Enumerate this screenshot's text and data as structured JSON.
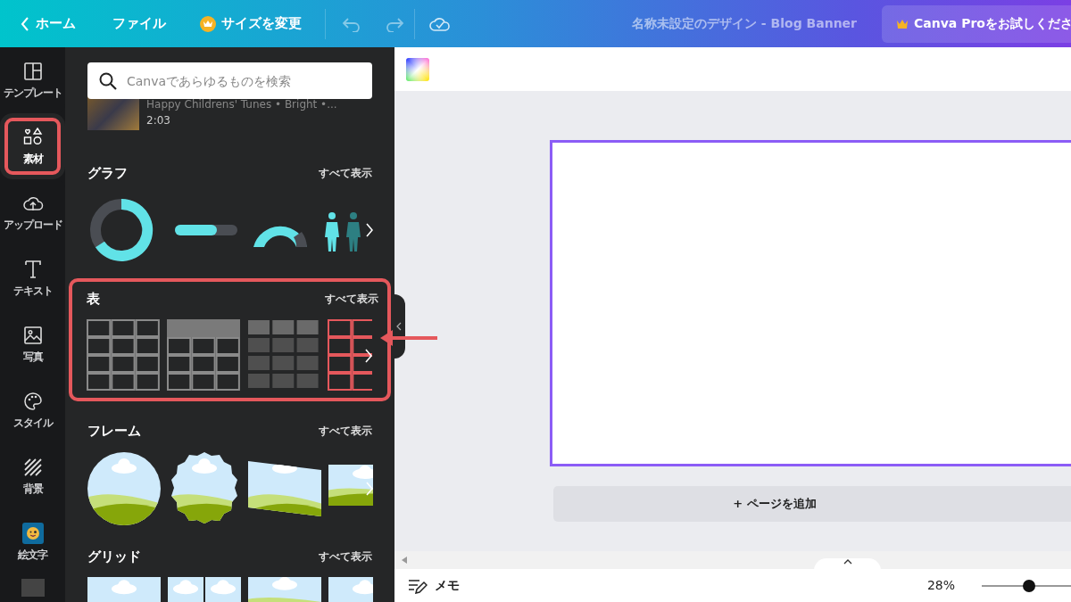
{
  "topbar": {
    "home": "ホーム",
    "file": "ファイル",
    "resize": "サイズを変更",
    "title": "名称未設定のデザイン - Blog Banner",
    "pro": "Canva Proをお試しくださ"
  },
  "rail": [
    {
      "label": "テンプレート",
      "kind": "template",
      "selected": false,
      "highlighted": false
    },
    {
      "label": "素材",
      "kind": "elements",
      "selected": true,
      "highlighted": true
    },
    {
      "label": "アップロード",
      "kind": "upload",
      "selected": false,
      "highlighted": false
    },
    {
      "label": "テキスト",
      "kind": "text",
      "selected": false,
      "highlighted": false
    },
    {
      "label": "写真",
      "kind": "photo",
      "selected": false,
      "highlighted": false
    },
    {
      "label": "スタイル",
      "kind": "style",
      "selected": false,
      "highlighted": false
    },
    {
      "label": "背景",
      "kind": "background",
      "selected": false,
      "highlighted": false
    },
    {
      "label": "絵文字",
      "kind": "emoji",
      "selected": false,
      "highlighted": false
    }
  ],
  "search": {
    "placeholder": "Canvaであらゆるものを検索"
  },
  "audio": {
    "title": "Happy Childrens' Tunes • Bright •...",
    "duration": "2:03"
  },
  "sections": [
    {
      "title": "グラフ",
      "see_all": "すべて表示",
      "kind": "chart",
      "highlighted": false
    },
    {
      "title": "表",
      "see_all": "すべて表示",
      "kind": "table",
      "highlighted": true
    },
    {
      "title": "フレーム",
      "see_all": "すべて表示",
      "kind": "frame",
      "highlighted": false
    },
    {
      "title": "グリッド",
      "see_all": "すべて表示",
      "kind": "grid",
      "highlighted": false
    }
  ],
  "canvas": {
    "add_page": "+ ページを追加"
  },
  "footer": {
    "memo": "メモ",
    "zoom": "28%",
    "zoom_slider": {
      "level": 0.53
    }
  }
}
